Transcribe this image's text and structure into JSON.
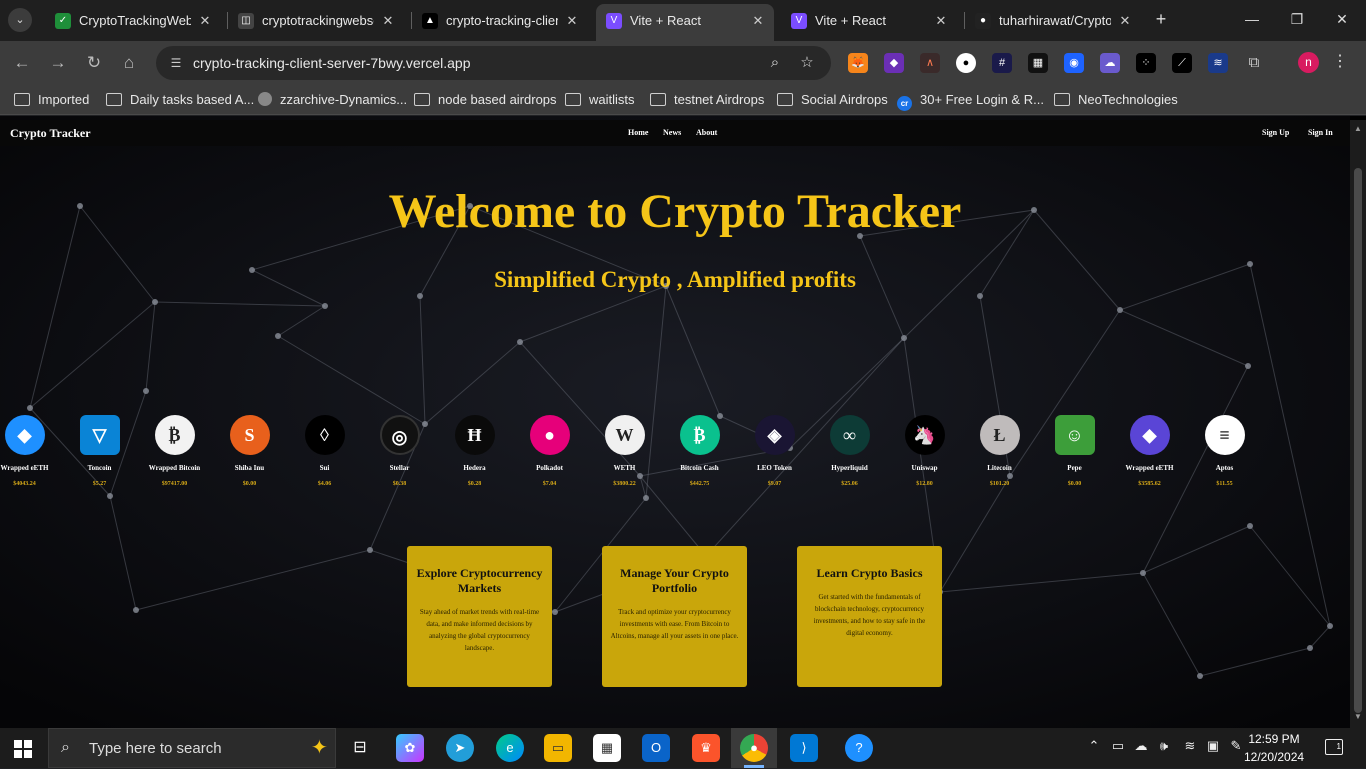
{
  "browser": {
    "tabs": [
      {
        "title": "CryptoTrackingWebSe",
        "fav_color": "#1f8f3a",
        "fav_glyph": "✓",
        "active": false
      },
      {
        "title": "cryptotrackingwebsev",
        "fav_color": "#444444",
        "fav_glyph": "◫",
        "active": false
      },
      {
        "title": "crypto-tracking-client",
        "fav_color": "#000000",
        "fav_glyph": "▲",
        "active": false
      },
      {
        "title": "Vite + React",
        "fav_color": "#7b4dff",
        "fav_glyph": "V",
        "active": true
      },
      {
        "title": "Vite + React",
        "fav_color": "#7b4dff",
        "fav_glyph": "V",
        "active": false
      },
      {
        "title": "tuharhirawat/CryptoT",
        "fav_color": "#222222",
        "fav_glyph": "●",
        "active": false
      }
    ],
    "url": "crypto-tracking-client-server-7bwy.vercel.app",
    "bookmarks": [
      {
        "label": "Imported",
        "icon": "folder-icon"
      },
      {
        "label": "Daily tasks based A...",
        "icon": "folder-icon"
      },
      {
        "label": "zzarchive-Dynamics...",
        "icon": "github-icon"
      },
      {
        "label": "node based airdrops",
        "icon": "folder-icon"
      },
      {
        "label": "waitlists",
        "icon": "folder-icon"
      },
      {
        "label": "testnet Airdrops",
        "icon": "folder-icon"
      },
      {
        "label": "Social Airdrops",
        "icon": "folder-icon"
      },
      {
        "label": "30+ Free Login & R...",
        "icon": "cr-icon"
      },
      {
        "label": "NeoTechnologies",
        "icon": "folder-icon"
      }
    ],
    "profile_initial": "n"
  },
  "site": {
    "brand": "Crypto Tracker",
    "nav": [
      "Home",
      "News",
      "About"
    ],
    "auth": [
      "Sign Up",
      "Sign In"
    ],
    "hero_title": "Welcome to Crypto Tracker",
    "hero_subtitle": "Simplified Crypto , Amplified profits",
    "coins": [
      {
        "name": "Wrapped eETH",
        "price": "$4043.24",
        "color": "#1e90ff",
        "glyph": "◆"
      },
      {
        "name": "Toncoin",
        "price": "$5.27",
        "color": "#0a84d6",
        "glyph": "▽"
      },
      {
        "name": "Wrapped Bitcoin",
        "price": "$97417.00",
        "color": "#f2f2f2",
        "glyph": "₿"
      },
      {
        "name": "Shiba Inu",
        "price": "$0.00",
        "color": "#e8601c",
        "glyph": "S"
      },
      {
        "name": "Sui",
        "price": "$4.06",
        "color": "#000000",
        "glyph": "◊"
      },
      {
        "name": "Stellar",
        "price": "$0.38",
        "color": "#111111",
        "glyph": "◎"
      },
      {
        "name": "Hedera",
        "price": "$0.28",
        "color": "#0a0a0a",
        "glyph": "Ħ"
      },
      {
        "name": "Polkadot",
        "price": "$7.04",
        "color": "#e6007a",
        "glyph": "●"
      },
      {
        "name": "WETH",
        "price": "$3800.22",
        "color": "#f0f0f0",
        "glyph": "W"
      },
      {
        "name": "Bitcoin Cash",
        "price": "$442.75",
        "color": "#0ac18e",
        "glyph": "₿"
      },
      {
        "name": "LEO Token",
        "price": "$9.07",
        "color": "#1a1533",
        "glyph": "◈"
      },
      {
        "name": "Hyperliquid",
        "price": "$25.06",
        "color": "#0d3b36",
        "glyph": "∞"
      },
      {
        "name": "Uniswap",
        "price": "$12.80",
        "color": "#000000",
        "glyph": "🦄"
      },
      {
        "name": "Litecoin",
        "price": "$101.20",
        "color": "#bfbbbb",
        "glyph": "Ł"
      },
      {
        "name": "Pepe",
        "price": "$0.00",
        "color": "#3d9e3a",
        "glyph": "☺"
      },
      {
        "name": "Wrapped eETH",
        "price": "$3585.62",
        "color": "#5a45d6",
        "glyph": "◆"
      },
      {
        "name": "Aptos",
        "price": "$11.55",
        "color": "#ffffff",
        "glyph": "≡"
      }
    ],
    "cards": [
      {
        "title": "Explore Cryptocurrency Markets",
        "body": "Stay ahead of market trends with real-time data, and make informed decisions by analyzing the global cryptocurrency landscape."
      },
      {
        "title": "Manage Your Crypto Portfolio",
        "body": "Track and optimize your cryptocurrency investments with ease. From Bitcoin to Altcoins, manage all your assets in one place."
      },
      {
        "title": "Learn Crypto Basics",
        "body": "Get started with the fundamentals of blockchain technology, cryptocurrency investments, and how to stay safe in the digital economy."
      }
    ]
  },
  "taskbar": {
    "search_placeholder": "Type here to search",
    "time": "12:59 PM",
    "date": "12/20/2024",
    "notifications": "1"
  }
}
